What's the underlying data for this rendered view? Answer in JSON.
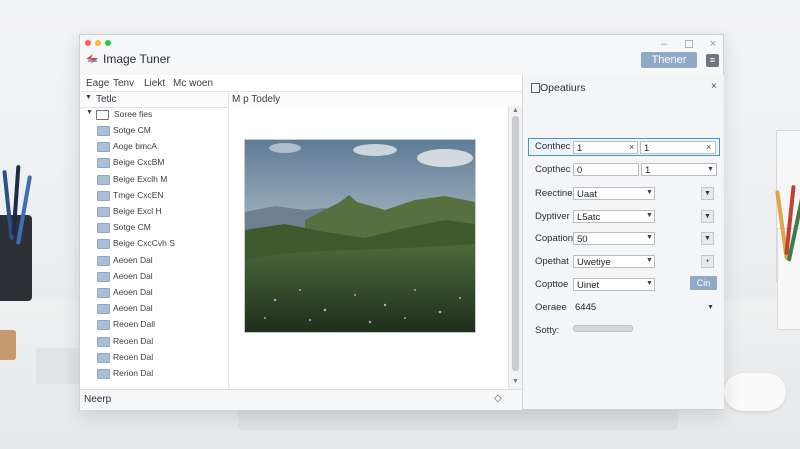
{
  "window": {
    "title": "Image Tuner",
    "controls": {
      "minimize": "–",
      "maximize": "☐",
      "close": "×"
    },
    "theme_button": "Thener",
    "theme_extra": "≡"
  },
  "menu": [
    "Eage",
    "Tenv",
    "Liekt",
    "Mc woen"
  ],
  "tree": {
    "header": "Tetlc",
    "root": "Soree fies",
    "items": [
      "Sotge CM",
      "Aoge bmcA",
      "Beige CxcBM",
      "Beige Exclh M",
      "Tmge CxcEN",
      "Beige Excl H",
      "Sotge CM",
      "Beige CxcCvh S",
      "Aeoen Dal",
      "Aeoen Dal",
      "Aeoen Dal",
      "Aeoen Dal",
      "Reoen Dall",
      "Reoen Dal",
      "Reoen Dal",
      "Rerion Dal"
    ]
  },
  "preview": {
    "header": "M p Todely"
  },
  "status": {
    "label": "Neerp",
    "icon": "diamond-icon"
  },
  "panel": {
    "title": "Opeatiurs",
    "close": "×",
    "rows": [
      {
        "label": "Conthec",
        "value1": "1",
        "value2": "1",
        "x1": "×",
        "x2": "×"
      },
      {
        "label": "Copthec",
        "value1": "0",
        "value2": "1"
      },
      {
        "label": "Reectine",
        "value": "Uaat"
      },
      {
        "label": "Dyptiver",
        "value": "L5atc"
      },
      {
        "label": "Copation",
        "value": "50"
      },
      {
        "label": "Opethat",
        "value": "Uwetiye"
      },
      {
        "label": "Copttoe",
        "value": "Uinet",
        "button": "Cin"
      },
      {
        "label": "Oeraee",
        "value": "6445"
      },
      {
        "label": "Sotty:"
      }
    ]
  },
  "colors": {
    "accent": "#8fa9c7",
    "selection": "#4f8fd1",
    "folder": "#a8bfd8"
  }
}
